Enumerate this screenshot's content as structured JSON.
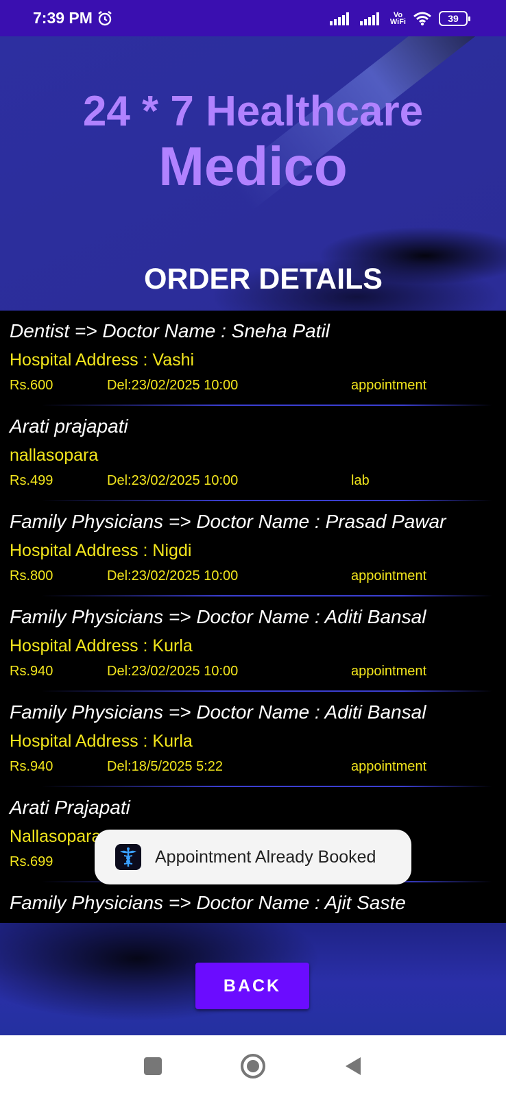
{
  "status_bar": {
    "time": "7:39 PM",
    "network_label": "Vo\nWiFi",
    "battery": "39"
  },
  "header": {
    "title": "24 * 7 Healthcare",
    "app_name": "Medico",
    "section_title": "ORDER DETAILS"
  },
  "orders": [
    {
      "title": "Dentist => Doctor Name : Sneha Patil",
      "address": "Hospital Address : Vashi",
      "price": "Rs.600",
      "date": "Del:23/02/2025 10:00",
      "type": "appointment"
    },
    {
      "title": "Arati prajapati",
      "address": "nallasopara",
      "price": "Rs.499",
      "date": "Del:23/02/2025 10:00",
      "type": "lab"
    },
    {
      "title": "Family Physicians => Doctor Name : Prasad Pawar",
      "address": "Hospital Address : Nigdi",
      "price": "Rs.800",
      "date": "Del:23/02/2025 10:00",
      "type": "appointment"
    },
    {
      "title": "Family Physicians => Doctor Name : Aditi Bansal",
      "address": "Hospital Address : Kurla",
      "price": "Rs.940",
      "date": "Del:23/02/2025 10:00",
      "type": "appointment"
    },
    {
      "title": "Family Physicians => Doctor Name : Aditi Bansal",
      "address": "Hospital Address : Kurla",
      "price": "Rs.940",
      "date": "Del:18/5/2025 5:22",
      "type": "appointment"
    },
    {
      "title": "Arati Prajapati",
      "address": "Nallasopara",
      "price": "Rs.699",
      "date": "",
      "type": ""
    },
    {
      "title": "Family Physicians => Doctor Name : Ajit Saste",
      "address": "",
      "price": "",
      "date": "",
      "type": ""
    }
  ],
  "toast": {
    "message": "Appointment Already Booked"
  },
  "back_button": {
    "label": "BACK"
  },
  "colors": {
    "accent": "#6b0cff",
    "title": "#b182ff",
    "highlight": "#f2e51c",
    "status_bar": "#3a0fb0"
  }
}
